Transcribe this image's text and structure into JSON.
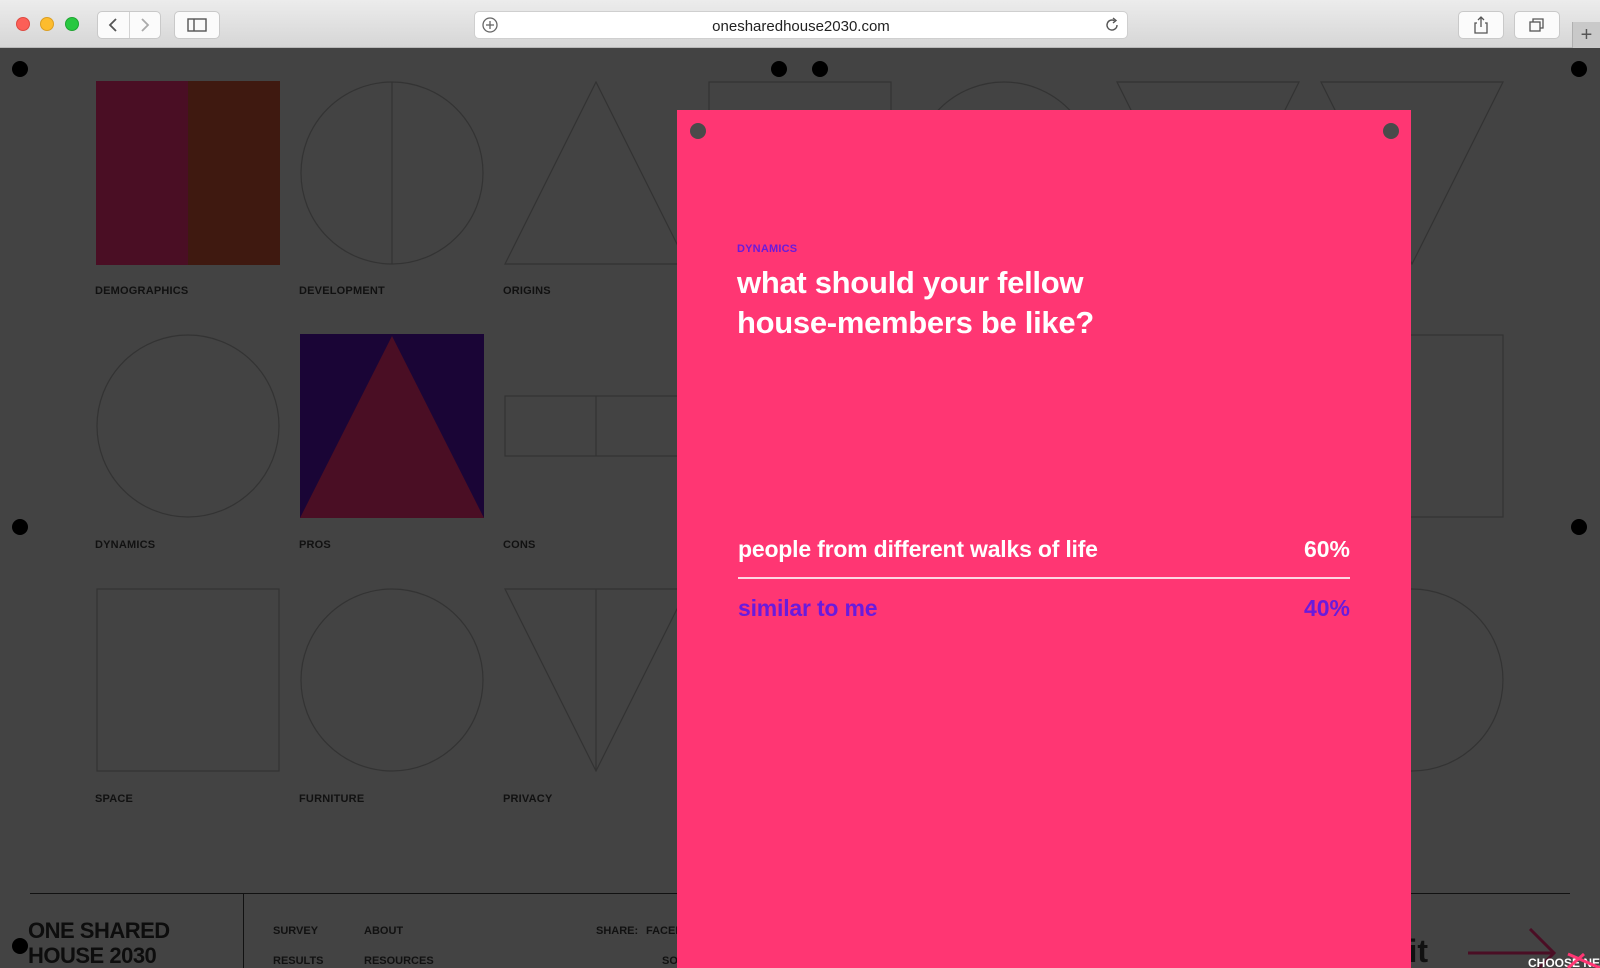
{
  "browser": {
    "url": "onesharedhouse2030.com"
  },
  "grid": {
    "tiles": [
      {
        "label": "DEMOGRAPHICS"
      },
      {
        "label": "DEVELOPMENT"
      },
      {
        "label": "ORIGINS"
      },
      {
        "label": "DYNAMICS"
      },
      {
        "label": "PROS"
      },
      {
        "label": "CONS"
      },
      {
        "label": "SPACE"
      },
      {
        "label": "FURNITURE"
      },
      {
        "label": "PRIVACY"
      }
    ]
  },
  "footer": {
    "title": "ONE SHARED HOUSE 2030",
    "links": {
      "survey": "SURVEY",
      "about": "ABOUT",
      "results": "RESULTS",
      "resources": "RESOURCES",
      "share": "SHARE:",
      "facebook_partial": "FACEB",
      "so_partial": "SO"
    },
    "submit_partial": "mit",
    "choose_next": "CHOOSE NE"
  },
  "card": {
    "category": "DYNAMICS",
    "question": "what should your fellow house-members be like?",
    "answers": [
      {
        "text": "people from different walks of life",
        "percent": "60%",
        "share": 0.6
      },
      {
        "text": "similar to me",
        "percent": "40%",
        "share": 0.4
      }
    ]
  },
  "colors": {
    "page_bg": "#434343",
    "card_bg": "#ff3673",
    "accent_purple": "#6a1bdc",
    "demographics_left": "#4a0e24",
    "demographics_right": "#3f1910",
    "pros_bg": "#1a0536",
    "pros_triangle": "#4a0e24"
  }
}
